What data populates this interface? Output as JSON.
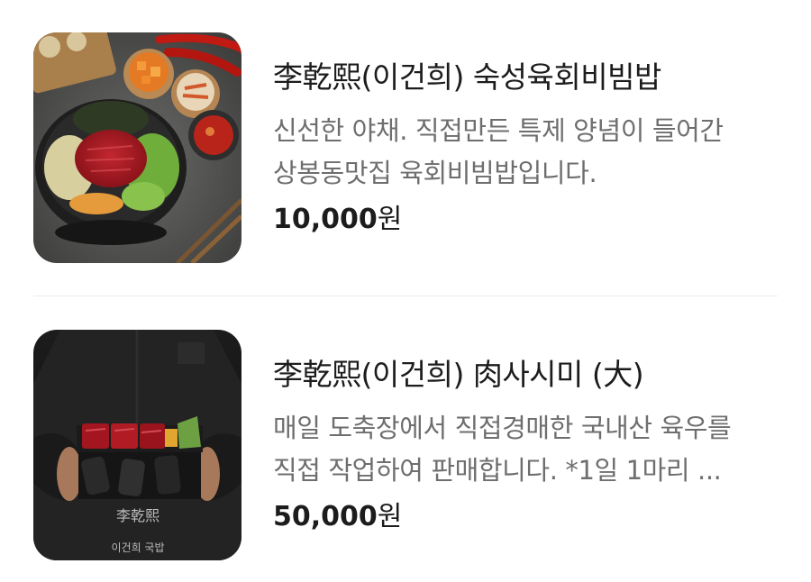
{
  "menu": {
    "items": [
      {
        "name": "李乾熙(이건희) 숙성육회비빔밥",
        "description": "신선한 야채. 직접만든 특제 양념이 들어간\n상봉동맛집 육회비빔밥입니다.",
        "price_amount": "10,000",
        "price_unit": "원",
        "image_icon": "bibimbap-photo"
      },
      {
        "name": "李乾熙(이건희) 肉사시미 (大)",
        "description": "매일 도축장에서 직접경매한 국내산 육우를\n직접 작업하여 판매합니다. *1일 1마리 ...",
        "price_amount": "50,000",
        "price_unit": "원",
        "image_icon": "meat-sashimi-photo",
        "image_text": [
          "李乾熙",
          "이건희 국밥"
        ]
      }
    ]
  },
  "colors": {
    "title": "#1c1c1c",
    "description": "#6e6e6e",
    "divider": "#ececec"
  }
}
